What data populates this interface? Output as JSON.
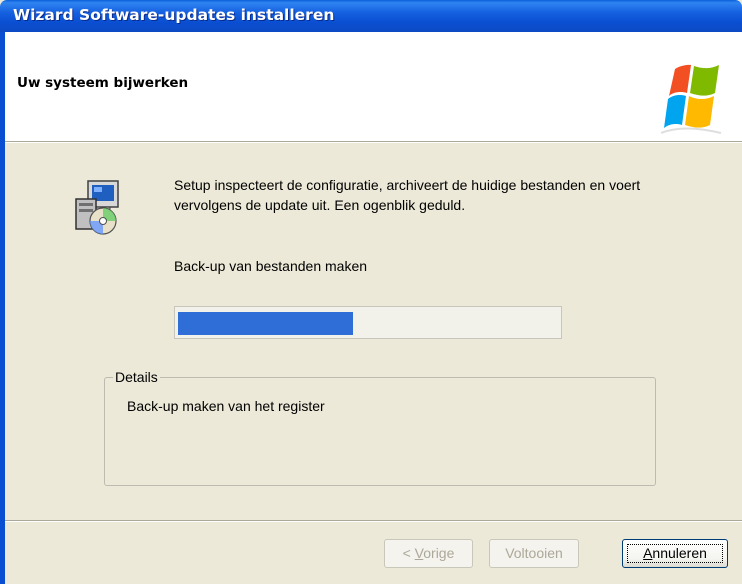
{
  "window": {
    "title": "Wizard Software-updates installeren"
  },
  "header": {
    "heading": "Uw systeem bijwerken",
    "logo_icon": "windows-flag-logo"
  },
  "body": {
    "setup_icon": "setup-package-icon",
    "description": "Setup inspecteert de configuratie, archiveert de huidige bestanden en voert vervolgens de update uit. Een ogenblik geduld.",
    "status": "Back-up van bestanden maken",
    "progress_percent": 46,
    "progress_color": "#2f6ed6"
  },
  "details": {
    "legend": "Details",
    "text": "Back-up maken van het register"
  },
  "buttons": {
    "back": {
      "prefix": "< ",
      "mnemonic": "V",
      "rest": "orige",
      "enabled": false
    },
    "finish": {
      "label": "Voltooien",
      "enabled": false
    },
    "cancel": {
      "mnemonic": "A",
      "rest": "nnuleren",
      "enabled": true
    }
  }
}
